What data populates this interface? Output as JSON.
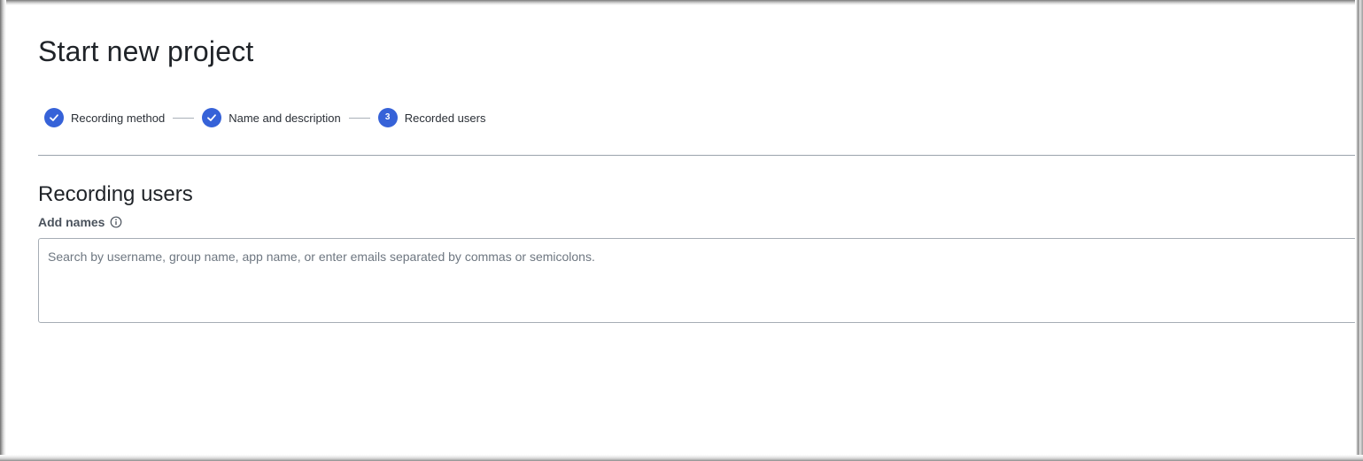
{
  "page": {
    "title": "Start new project"
  },
  "stepper": {
    "steps": [
      {
        "label": "Recording method",
        "state": "complete",
        "icon": "checkmark-icon"
      },
      {
        "label": "Name and description",
        "state": "complete",
        "icon": "checkmark-icon"
      },
      {
        "label": "Recorded users",
        "state": "current",
        "number": "3"
      }
    ]
  },
  "section": {
    "title": "Recording users",
    "field_label": "Add names",
    "info_icon": "info-icon",
    "input": {
      "placeholder": "Search by username, group name, app name, or enter emails separated by commas or semicolons.",
      "value": ""
    }
  },
  "colors": {
    "accent": "#3662d8",
    "text": "#1f2328",
    "label": "#4a525c",
    "divider": "#9aa3ac",
    "border": "#a6adb5"
  }
}
